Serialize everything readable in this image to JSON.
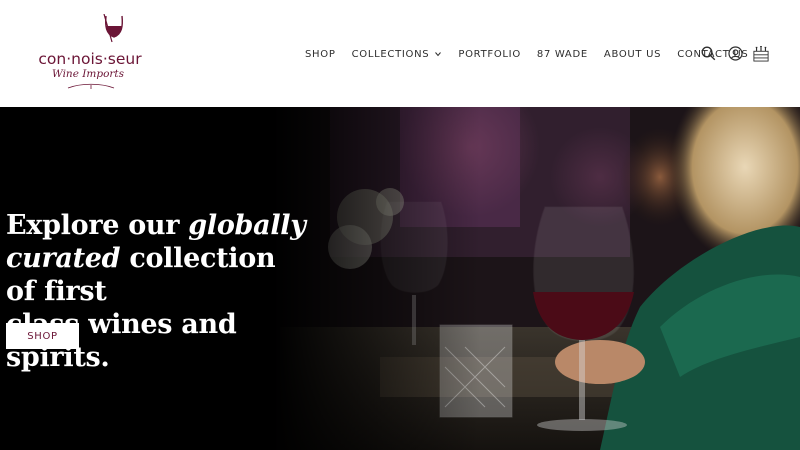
{
  "brand": {
    "name": "con·nois·seur",
    "tagline": "Wine Imports",
    "color": "#6b1536"
  },
  "nav": {
    "items": [
      {
        "label": "SHOP"
      },
      {
        "label": "COLLECTIONS",
        "has_dropdown": true
      },
      {
        "label": "PORTFOLIO"
      },
      {
        "label": "87 WADE"
      },
      {
        "label": "ABOUT US"
      },
      {
        "label": "CONTACT US"
      }
    ]
  },
  "header_icons": [
    "search-icon",
    "account-icon",
    "cart-icon"
  ],
  "hero": {
    "line1_plain": "Explore our ",
    "line1_italic": "globally",
    "line2_italic": "curated",
    "line2_plain": " collection of first",
    "line3_plain": "class wines and spirits.",
    "button_label": "SHOP"
  }
}
